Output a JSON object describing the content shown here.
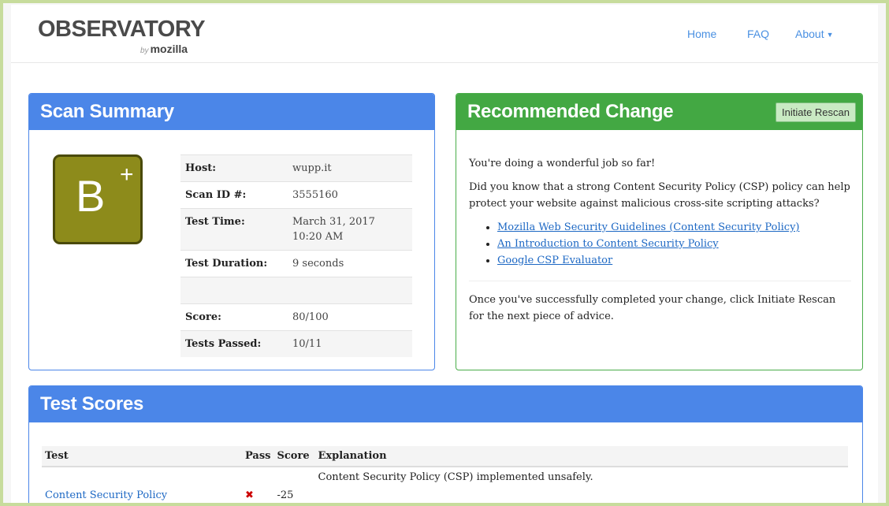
{
  "brand": {
    "title": "OBSERVATORY",
    "by": "by",
    "sub": "mozilla"
  },
  "nav": {
    "home": "Home",
    "faq": "FAQ",
    "about": "About"
  },
  "scan_summary": {
    "title": "Scan Summary",
    "grade": {
      "letter": "B",
      "modifier": "+"
    },
    "rows": [
      {
        "label": "Host:",
        "value": "wupp.it"
      },
      {
        "label": "Scan ID #:",
        "value": "3555160"
      },
      {
        "label": "Test Time:",
        "value": "March 31, 2017 10:20 AM"
      },
      {
        "label": "Test Duration:",
        "value": "9 seconds"
      },
      {
        "label": "",
        "value": ""
      },
      {
        "label": "Score:",
        "value": "80/100"
      },
      {
        "label": "Tests Passed:",
        "value": "10/11"
      }
    ]
  },
  "recommended": {
    "title": "Recommended Change",
    "rescan_label": "Initiate Rescan",
    "intro": "You're doing a wonderful job so far!",
    "body": "Did you know that a strong Content Security Policy (CSP) policy can help protect your website against malicious cross-site scripting attacks?",
    "links": [
      "Mozilla Web Security Guidelines (Content Security Policy)",
      "An Introduction to Content Security Policy",
      "Google CSP Evaluator"
    ],
    "outro": "Once you've successfully completed your change, click Initiate Rescan for the next piece of advice."
  },
  "test_scores": {
    "title": "Test Scores",
    "columns": [
      "Test",
      "Pass",
      "Score",
      "Explanation"
    ],
    "rows": [
      {
        "test": "Content Security Policy",
        "pass": "✖",
        "score": "-25",
        "explanation": "Content Security Policy (CSP) implemented unsafely."
      }
    ]
  },
  "colors": {
    "blue_header": "#4b86e8",
    "green_header": "#43a843",
    "grade_bg": "#8d8b1b",
    "link": "#1d68c4"
  }
}
